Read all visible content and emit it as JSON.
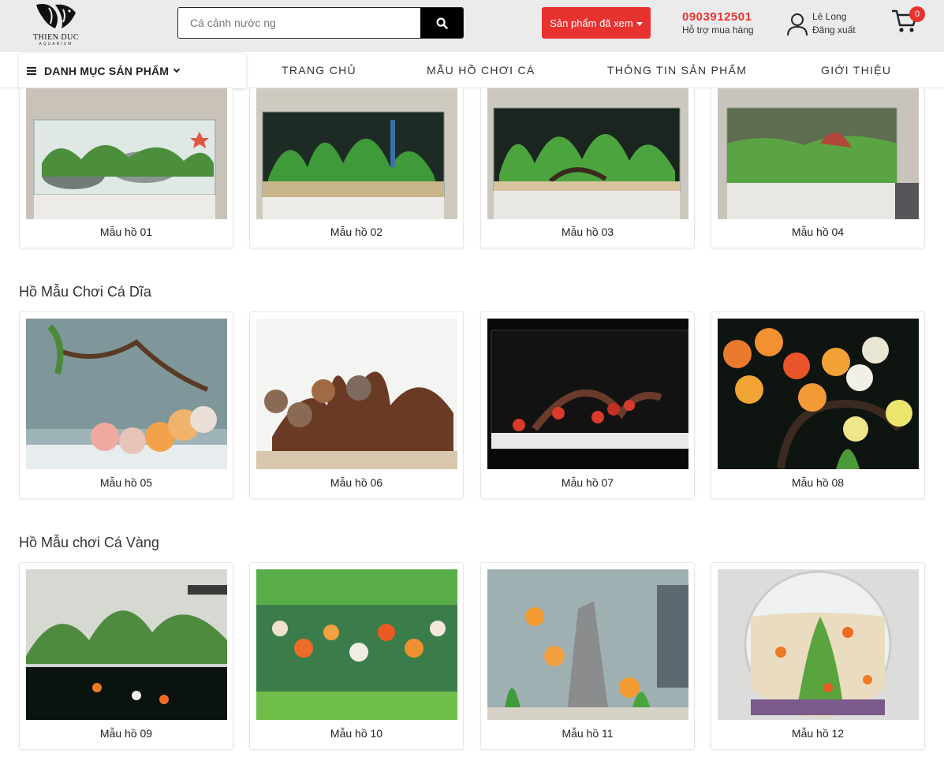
{
  "header": {
    "logo_text": "THIEN DUC",
    "logo_sub": "AQUARIUM",
    "search_placeholder": "Cá cảnh nước ng",
    "viewed_button": "Sản phẩm đã xem",
    "hotline_number": "0903912501",
    "hotline_label": "Hỗ trợ mua hàng",
    "user_name": "Lê Long",
    "logout_label": "Đăng xuất",
    "cart_count": "0"
  },
  "nav": {
    "category_menu": "DANH MỤC SẢN PHẨM",
    "items": [
      "TRANG CHỦ",
      "MẪU HỒ CHƠI CÁ",
      "THÔNG TIN SẢN PHẨM",
      "GIỚI THIỆU"
    ]
  },
  "sections": [
    {
      "title": "",
      "products": [
        "Mẫu hồ 01",
        "Mẫu hồ 02",
        "Mẫu hồ 03",
        "Mẫu hồ 04"
      ]
    },
    {
      "title": "Hồ Mẫu Chơi Cá Dĩa",
      "products": [
        "Mẫu hồ 05",
        "Mẫu hồ 06",
        "Mẫu hồ 07",
        "Mẫu hồ 08"
      ]
    },
    {
      "title": "Hồ Mẫu chơi Cá Vàng",
      "products": [
        "Mẫu hồ 09",
        "Mẫu hồ 10",
        "Mẫu hồ 11",
        "Mẫu hồ 12"
      ]
    }
  ],
  "theme": {
    "accent": "#e8322f",
    "header_bg": "#ebebeb"
  }
}
